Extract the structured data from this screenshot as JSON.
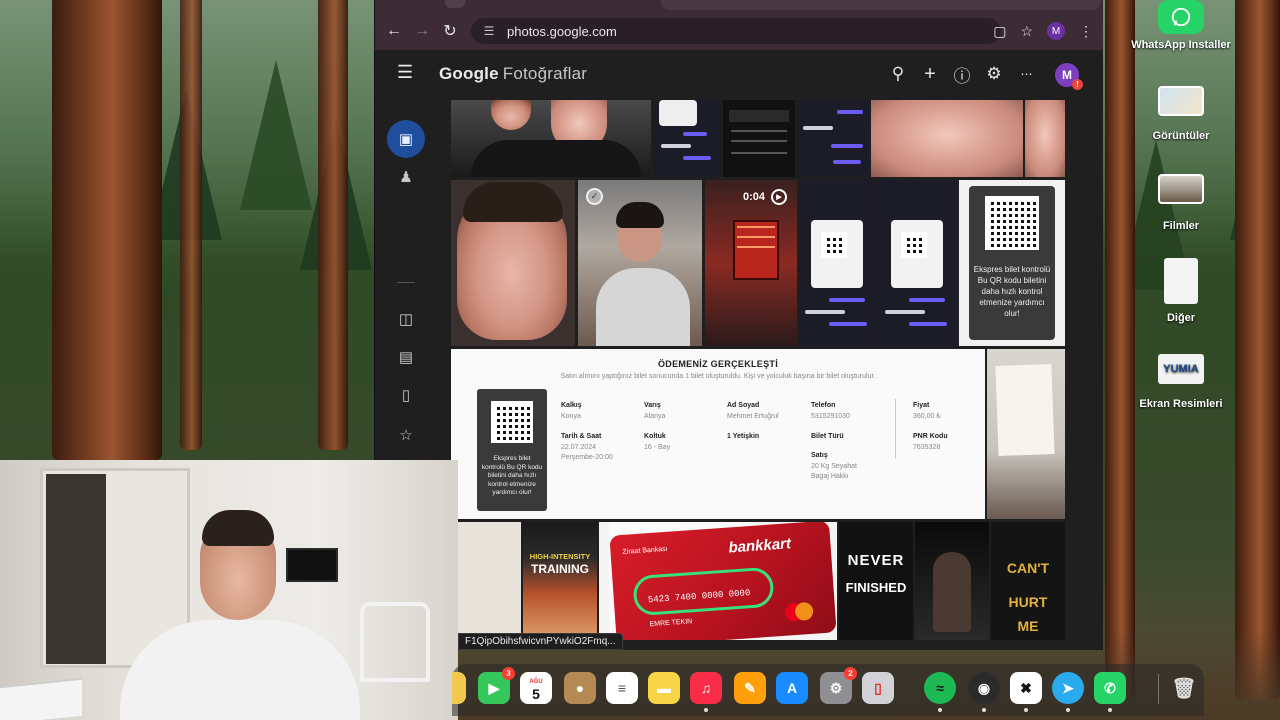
{
  "browser": {
    "url": "photos.google.com",
    "status_url": "F1QipObihsfwicvnPYwkiO2Fmq...",
    "profile_initial": "M"
  },
  "app": {
    "logo_google": "Google",
    "logo_product": "Fotoğraflar",
    "avatar_initial": "M",
    "avatar_alert": "!"
  },
  "photos": {
    "video_duration": "0:04",
    "qr_caption": "Ekspres bilet kontrolü Bu QR kodu biletini daha hızlı kontrol etmenize yardımcı olur!",
    "receipt": {
      "title": "ÖDEMENİZ GERÇEKLEŞTİ",
      "subtitle": "Satın alımını yaptığınız bilet sonucunda 1 bilet oluşturuldu. Kişi ve yolculuk başına bir bilet oluşturulur.",
      "qr_caption": "Ekspres bilet kontrolü Bu QR kodu biletini daha hızlı kontrol etmenize yardımcı olur!",
      "kalkis_label": "Kalkış",
      "kalkis_val": "Konya",
      "varis_label": "Varış",
      "varis_val": "Alanya",
      "adsoyad_label": "Ad Soyad",
      "adsoyad_val": "Mehmet Ertuğrul",
      "telefon_label": "Telefon",
      "telefon_val": "5315291030",
      "fiyat_label": "Fiyat",
      "fiyat_val": "360,00 ₺",
      "tarih_label": "Tarih & Saat",
      "tarih_val1": "22.07.2024",
      "tarih_val2": "Perşembe-20:00",
      "koltuk_label": "Koltuk",
      "koltuk_val": "16 - Bay",
      "yetiskin_label": "1 Yetişkin",
      "bilet_turu_label": "Bilet Türü",
      "pnr_label": "PNR Kodu",
      "pnr_val": "7635328",
      "satis_label": "Satış",
      "satis_val1": "20 Kg Seyahat",
      "satis_val2": "Bagaj Hakkı"
    },
    "poster_training_1": "HIGH-INTENSITY",
    "poster_training_2": "TRAINING",
    "bank_brand": "bankkart",
    "bank_name": "Ziraat Bankası",
    "card_number": "5423 7400 0000 0000",
    "card_holder": "EMRE TEKIN",
    "never_1": "NEVER",
    "never_2": "FINISHED",
    "cant_1": "CAN'T",
    "cant_2": "HURT",
    "cant_3": "ME"
  },
  "desktop": {
    "items": [
      {
        "label": "WhatsApp Installer"
      },
      {
        "label": "Görüntüler"
      },
      {
        "label": "Filmler"
      },
      {
        "label": "Diğer"
      },
      {
        "label": "Ekran Resimleri"
      }
    ],
    "yumia_text": "YUMIA"
  },
  "dock": {
    "facetime_badge": "3",
    "calendar_month": "AĞU",
    "calendar_day": "5",
    "settings_badge": "2"
  },
  "colors": {
    "accent_blue": "#1f4e9c",
    "browser_frame": "#3d2c35",
    "app_bg": "#1f1f1f",
    "bank_red": "#d81d2a"
  }
}
